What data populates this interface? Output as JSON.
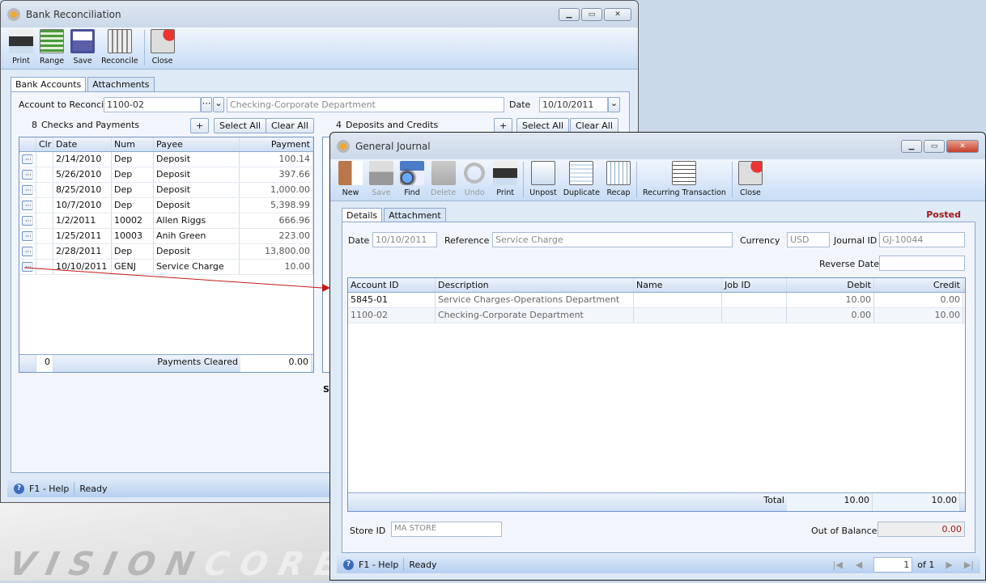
{
  "desktop": {
    "logo": "VISION",
    "logo2": "CORE"
  },
  "bank": {
    "title": "Bank Reconciliation",
    "toolbar": [
      "Print",
      "Range",
      "Save",
      "Reconcile",
      "Close"
    ],
    "tabs": [
      "Bank Accounts",
      "Attachments"
    ],
    "account_label": "Account to Reconcile",
    "account_value": "1100-02",
    "account_desc": "Checking-Corporate Department",
    "date_label": "Date",
    "date_value": "10/10/2011",
    "checks_count": "8",
    "checks_label": "Checks and Payments",
    "deposits_count": "4",
    "deposits_label": "Deposits and Credits",
    "plus": "+",
    "select_all": "Select All",
    "clear_all": "Clear All",
    "columns": [
      "Clr",
      "Date",
      "Num",
      "Payee",
      "Payment"
    ],
    "rows": [
      [
        "2/14/2010",
        "Dep",
        "Deposit",
        "100.14"
      ],
      [
        "5/26/2010",
        "Dep",
        "Deposit",
        "397.66"
      ],
      [
        "8/25/2010",
        "Dep",
        "Deposit",
        "1,000.00"
      ],
      [
        "10/7/2010",
        "Dep",
        "Deposit",
        "5,398.99"
      ],
      [
        "1/2/2011",
        "10002",
        "Allen Riggs",
        "666.96"
      ],
      [
        "1/25/2011",
        "10003",
        "Anih Green",
        "223.00"
      ],
      [
        "2/28/2011",
        "Dep",
        "Deposit",
        "13,800.00"
      ],
      [
        "10/10/2011",
        "GENJ",
        "Service Charge",
        "10.00"
      ]
    ],
    "footer_count": "0",
    "payments_cleared_label": "Payments Cleared",
    "payments_cleared": "0.00",
    "partial_label": "S",
    "status": {
      "help": "F1 - Help",
      "ready": "Ready"
    }
  },
  "gj": {
    "title": "General Journal",
    "toolbar": [
      {
        "label": "New",
        "enabled": true
      },
      {
        "label": "Save",
        "enabled": false
      },
      {
        "label": "Find",
        "enabled": true
      },
      {
        "label": "Delete",
        "enabled": false
      },
      {
        "label": "Undo",
        "enabled": false
      },
      {
        "label": "Print",
        "enabled": true
      },
      {
        "label": "Unpost",
        "enabled": true
      },
      {
        "label": "Duplicate",
        "enabled": true
      },
      {
        "label": "Recap",
        "enabled": true
      },
      {
        "label": "Recurring Transaction",
        "enabled": true
      },
      {
        "label": "Close",
        "enabled": true
      }
    ],
    "tabs": [
      "Details",
      "Attachment"
    ],
    "posted": "Posted",
    "posted_color": "#a01818",
    "date_label": "Date",
    "date_value": "10/10/2011",
    "reference_label": "Reference",
    "reference_value": "Service Charge",
    "currency_label": "Currency",
    "currency_value": "USD",
    "journal_label": "Journal ID",
    "journal_value": "GJ-10044",
    "reverse_label": "Reverse Date",
    "reverse_value": "",
    "columns": [
      "Account ID",
      "Description",
      "Name",
      "Job ID",
      "Debit",
      "Credit"
    ],
    "rows": [
      [
        "5845-01",
        "Service Charges-Operations Department",
        "",
        "",
        "10.00",
        "0.00"
      ],
      [
        "1100-02",
        "Checking-Corporate Department",
        "",
        "",
        "0.00",
        "10.00"
      ]
    ],
    "total_label": "Total",
    "total_debit": "10.00",
    "total_credit": "10.00",
    "store_label": "Store ID",
    "store_value": "MA STORE",
    "oob_label": "Out of Balance",
    "oob_value": "0.00",
    "status": {
      "help": "F1 - Help",
      "ready": "Ready",
      "page": "1",
      "of": "of 1"
    }
  }
}
